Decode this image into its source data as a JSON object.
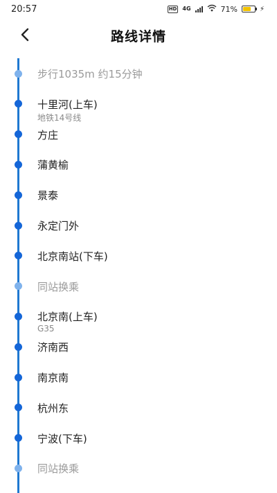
{
  "status_bar": {
    "time": "20:57",
    "hd_label": "HD",
    "network_label": "4G",
    "battery_percent_text": "71%",
    "battery_level": 0.71,
    "battery_color": "#f2c200"
  },
  "header": {
    "title": "路线详情",
    "back_icon": "chevron-left-icon"
  },
  "timeline": {
    "accent_color": "#1466d8",
    "stops": [
      {
        "name": "步行1035m 约15分钟",
        "sub": "",
        "muted": true
      },
      {
        "name": "十里河(上车)",
        "sub": "地铁14号线",
        "muted": false
      },
      {
        "name": "方庄",
        "sub": "",
        "muted": false
      },
      {
        "name": "蒲黄榆",
        "sub": "",
        "muted": false
      },
      {
        "name": "景泰",
        "sub": "",
        "muted": false
      },
      {
        "name": "永定门外",
        "sub": "",
        "muted": false
      },
      {
        "name": "北京南站(下车)",
        "sub": "",
        "muted": false
      },
      {
        "name": "同站换乘",
        "sub": "",
        "muted": true
      },
      {
        "name": "北京南(上车)",
        "sub": "G35",
        "muted": false
      },
      {
        "name": "济南西",
        "sub": "",
        "muted": false
      },
      {
        "name": "南京南",
        "sub": "",
        "muted": false
      },
      {
        "name": "杭州东",
        "sub": "",
        "muted": false
      },
      {
        "name": "宁波(下车)",
        "sub": "",
        "muted": false
      },
      {
        "name": "同站换乘",
        "sub": "",
        "muted": true
      }
    ]
  }
}
